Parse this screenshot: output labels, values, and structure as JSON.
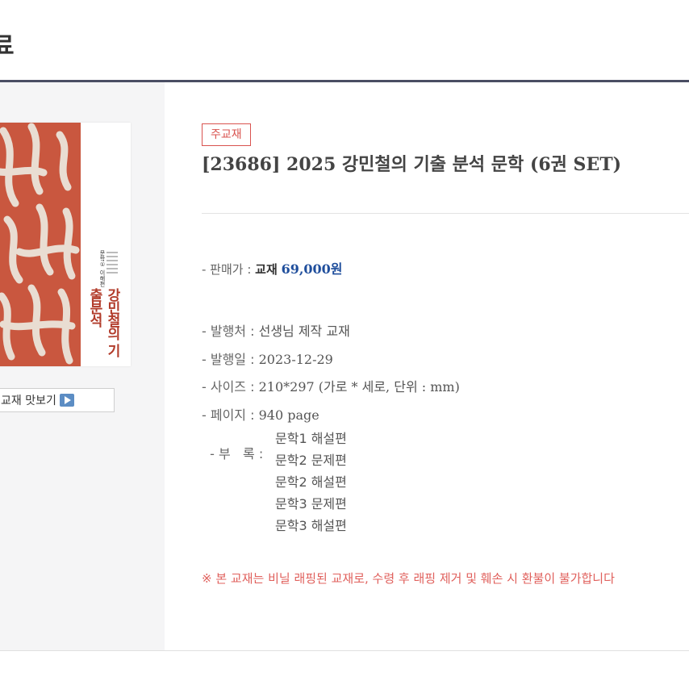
{
  "header": {
    "title": "료"
  },
  "cover": {
    "title": "강민철의 기출분석",
    "subtitle": "문학① 이해편"
  },
  "preview": {
    "label": "교재 맛보기",
    "icon": "play-icon"
  },
  "product": {
    "badge": "주교재",
    "title": "[23686] 2025 강민철의 기출 분석 문학 (6권 SET)"
  },
  "price": {
    "label": "- 판매가 : ",
    "type": "교재",
    "amount": "69,000원"
  },
  "info": {
    "publisher_label": "- 발행처 : ",
    "publisher": "선생님 제작 교재",
    "date_label": "- 발행일 : ",
    "date": "2023-12-29",
    "size_label": "- 사이즈 : ",
    "size": "210*297 (가로 * 세로, 단위 : mm)",
    "pages_label": "- 페이지 : ",
    "pages": "940 page",
    "appendix_label": "- 부   록 :",
    "appendix": [
      "문학1 해설편",
      "문학2 문제편",
      "문학2 해설편",
      "문학3 문제편",
      "문학3 해설편"
    ]
  },
  "notice": "※ 본 교재는 비닐 래핑된 교재로, 수령 후 래핑 제거 및 훼손 시 환불이 불가합니다",
  "colors": {
    "accent": "#d9534f",
    "price": "#1f4e9c",
    "cover": "#c9573f",
    "rule": "#4a4e63"
  }
}
